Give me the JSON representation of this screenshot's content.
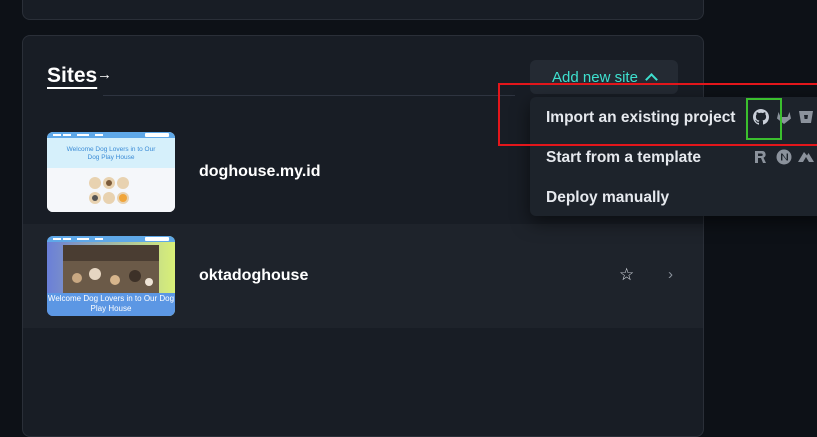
{
  "sites_section": {
    "title": "Sites",
    "title_arrow": "→",
    "add_new_site_label": "Add new site"
  },
  "sites": [
    {
      "name": "doghouse.my.id",
      "thumbnail_heading": "Welcome Dog Lovers in to Our Dog Play House"
    },
    {
      "name": "oktadoghouse",
      "thumbnail_heading": "Welcome Dog Lovers in to Our Dog Play House"
    }
  ],
  "dropdown": {
    "items": [
      {
        "label": "Import an existing project",
        "icons": [
          "github-icon",
          "gitlab-icon",
          "bitbucket-icon"
        ]
      },
      {
        "label": "Start from a template",
        "icons": [
          "remix-icon",
          "nextjs-icon",
          "nuxt-icon"
        ]
      },
      {
        "label": "Deploy manually",
        "icons": []
      }
    ]
  },
  "colors": {
    "background": "#0d1117",
    "card": "#181d25",
    "accent": "#3ee0cf",
    "highlight_red": "#e3161b",
    "highlight_green": "#3bbf2e"
  }
}
